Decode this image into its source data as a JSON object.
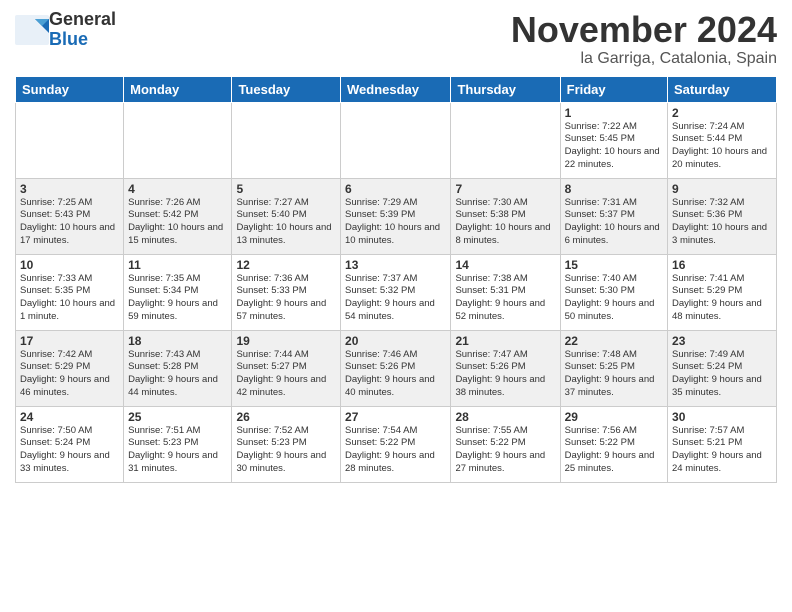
{
  "header": {
    "logo_line1": "General",
    "logo_line2": "Blue",
    "month_title": "November 2024",
    "location": "la Garriga, Catalonia, Spain"
  },
  "weekdays": [
    "Sunday",
    "Monday",
    "Tuesday",
    "Wednesday",
    "Thursday",
    "Friday",
    "Saturday"
  ],
  "weeks": [
    [
      {
        "day": "",
        "info": ""
      },
      {
        "day": "",
        "info": ""
      },
      {
        "day": "",
        "info": ""
      },
      {
        "day": "",
        "info": ""
      },
      {
        "day": "",
        "info": ""
      },
      {
        "day": "1",
        "info": "Sunrise: 7:22 AM\nSunset: 5:45 PM\nDaylight: 10 hours and 22 minutes."
      },
      {
        "day": "2",
        "info": "Sunrise: 7:24 AM\nSunset: 5:44 PM\nDaylight: 10 hours and 20 minutes."
      }
    ],
    [
      {
        "day": "3",
        "info": "Sunrise: 7:25 AM\nSunset: 5:43 PM\nDaylight: 10 hours and 17 minutes."
      },
      {
        "day": "4",
        "info": "Sunrise: 7:26 AM\nSunset: 5:42 PM\nDaylight: 10 hours and 15 minutes."
      },
      {
        "day": "5",
        "info": "Sunrise: 7:27 AM\nSunset: 5:40 PM\nDaylight: 10 hours and 13 minutes."
      },
      {
        "day": "6",
        "info": "Sunrise: 7:29 AM\nSunset: 5:39 PM\nDaylight: 10 hours and 10 minutes."
      },
      {
        "day": "7",
        "info": "Sunrise: 7:30 AM\nSunset: 5:38 PM\nDaylight: 10 hours and 8 minutes."
      },
      {
        "day": "8",
        "info": "Sunrise: 7:31 AM\nSunset: 5:37 PM\nDaylight: 10 hours and 6 minutes."
      },
      {
        "day": "9",
        "info": "Sunrise: 7:32 AM\nSunset: 5:36 PM\nDaylight: 10 hours and 3 minutes."
      }
    ],
    [
      {
        "day": "10",
        "info": "Sunrise: 7:33 AM\nSunset: 5:35 PM\nDaylight: 10 hours and 1 minute."
      },
      {
        "day": "11",
        "info": "Sunrise: 7:35 AM\nSunset: 5:34 PM\nDaylight: 9 hours and 59 minutes."
      },
      {
        "day": "12",
        "info": "Sunrise: 7:36 AM\nSunset: 5:33 PM\nDaylight: 9 hours and 57 minutes."
      },
      {
        "day": "13",
        "info": "Sunrise: 7:37 AM\nSunset: 5:32 PM\nDaylight: 9 hours and 54 minutes."
      },
      {
        "day": "14",
        "info": "Sunrise: 7:38 AM\nSunset: 5:31 PM\nDaylight: 9 hours and 52 minutes."
      },
      {
        "day": "15",
        "info": "Sunrise: 7:40 AM\nSunset: 5:30 PM\nDaylight: 9 hours and 50 minutes."
      },
      {
        "day": "16",
        "info": "Sunrise: 7:41 AM\nSunset: 5:29 PM\nDaylight: 9 hours and 48 minutes."
      }
    ],
    [
      {
        "day": "17",
        "info": "Sunrise: 7:42 AM\nSunset: 5:29 PM\nDaylight: 9 hours and 46 minutes."
      },
      {
        "day": "18",
        "info": "Sunrise: 7:43 AM\nSunset: 5:28 PM\nDaylight: 9 hours and 44 minutes."
      },
      {
        "day": "19",
        "info": "Sunrise: 7:44 AM\nSunset: 5:27 PM\nDaylight: 9 hours and 42 minutes."
      },
      {
        "day": "20",
        "info": "Sunrise: 7:46 AM\nSunset: 5:26 PM\nDaylight: 9 hours and 40 minutes."
      },
      {
        "day": "21",
        "info": "Sunrise: 7:47 AM\nSunset: 5:26 PM\nDaylight: 9 hours and 38 minutes."
      },
      {
        "day": "22",
        "info": "Sunrise: 7:48 AM\nSunset: 5:25 PM\nDaylight: 9 hours and 37 minutes."
      },
      {
        "day": "23",
        "info": "Sunrise: 7:49 AM\nSunset: 5:24 PM\nDaylight: 9 hours and 35 minutes."
      }
    ],
    [
      {
        "day": "24",
        "info": "Sunrise: 7:50 AM\nSunset: 5:24 PM\nDaylight: 9 hours and 33 minutes."
      },
      {
        "day": "25",
        "info": "Sunrise: 7:51 AM\nSunset: 5:23 PM\nDaylight: 9 hours and 31 minutes."
      },
      {
        "day": "26",
        "info": "Sunrise: 7:52 AM\nSunset: 5:23 PM\nDaylight: 9 hours and 30 minutes."
      },
      {
        "day": "27",
        "info": "Sunrise: 7:54 AM\nSunset: 5:22 PM\nDaylight: 9 hours and 28 minutes."
      },
      {
        "day": "28",
        "info": "Sunrise: 7:55 AM\nSunset: 5:22 PM\nDaylight: 9 hours and 27 minutes."
      },
      {
        "day": "29",
        "info": "Sunrise: 7:56 AM\nSunset: 5:22 PM\nDaylight: 9 hours and 25 minutes."
      },
      {
        "day": "30",
        "info": "Sunrise: 7:57 AM\nSunset: 5:21 PM\nDaylight: 9 hours and 24 minutes."
      }
    ]
  ]
}
